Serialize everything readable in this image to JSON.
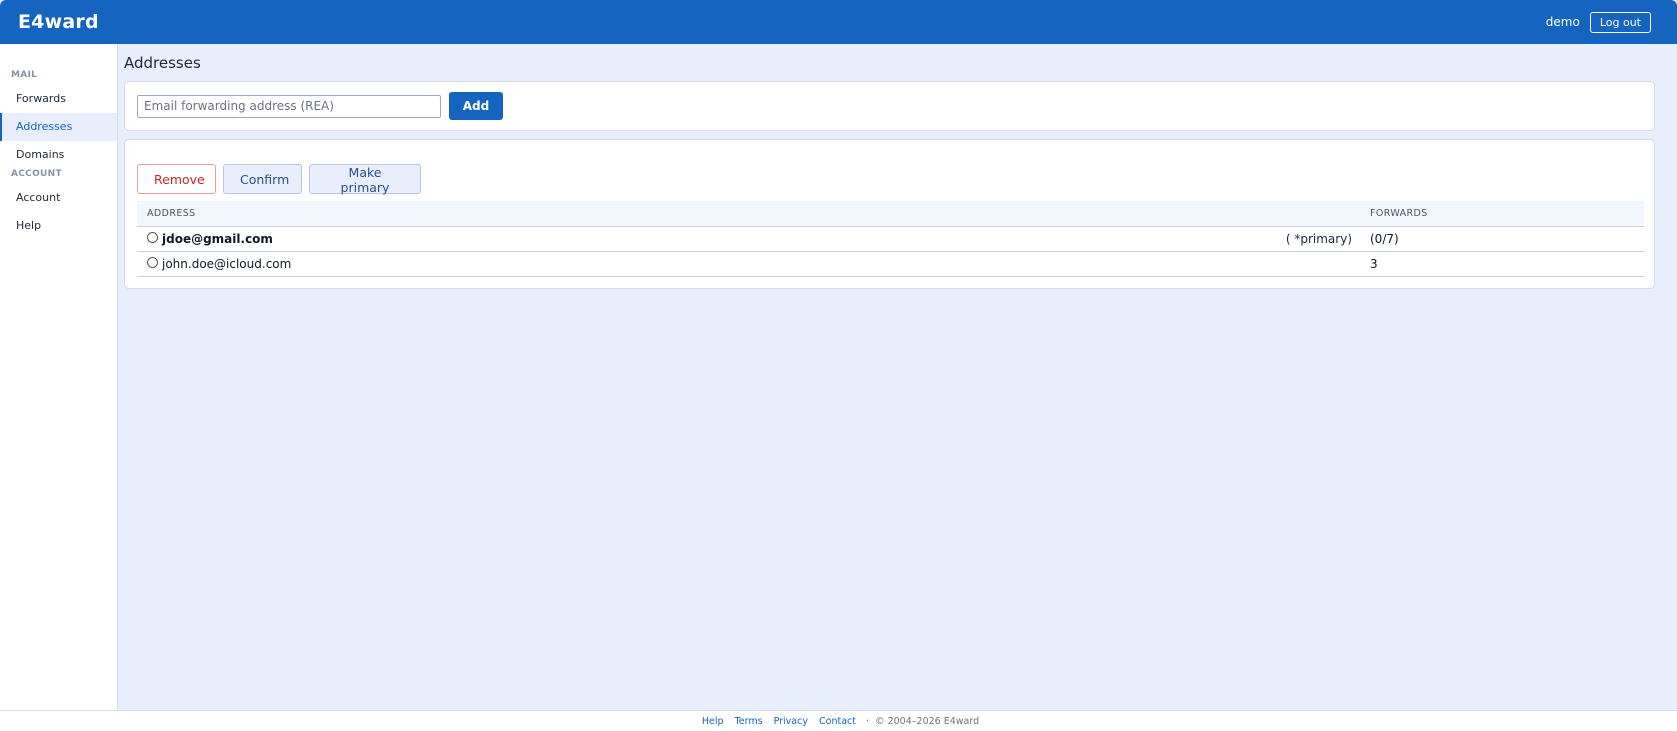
{
  "header": {
    "brand": "E4ward",
    "username": "demo",
    "logout_label": "Log out"
  },
  "sidebar": {
    "sections": [
      {
        "title": "MAIL",
        "items": [
          {
            "label": "Forwards",
            "active": false
          },
          {
            "label": "Addresses",
            "active": true
          },
          {
            "label": "Domains",
            "active": false
          }
        ]
      },
      {
        "title": "ACCOUNT",
        "items": [
          {
            "label": "Account",
            "active": false
          },
          {
            "label": "Help",
            "active": false
          }
        ]
      }
    ]
  },
  "main": {
    "title": "Addresses",
    "add_form": {
      "placeholder": "Email forwarding address (REA)",
      "value": "",
      "add_label": "Add"
    },
    "actions": {
      "remove_label": "Remove",
      "confirm_label": "Confirm",
      "make_primary_label": "Make primary"
    },
    "table": {
      "columns": [
        "ADDRESS",
        "FORWARDS"
      ],
      "rows": [
        {
          "address": "jdoe@gmail.com",
          "primary": "( *primary)",
          "forwards": "(0/7)",
          "bold": true
        },
        {
          "address": "john.doe@icloud.com",
          "primary": "",
          "forwards": "3",
          "bold": false
        }
      ]
    }
  },
  "footer": {
    "links": [
      "Help",
      "Terms",
      "Privacy",
      "Contact"
    ],
    "separator": "·",
    "copyright": "© 2004–2026 E4ward"
  },
  "colors": {
    "brand_blue": "#1565c0",
    "background": "#e8eefb",
    "remove_red": "#c62828"
  }
}
